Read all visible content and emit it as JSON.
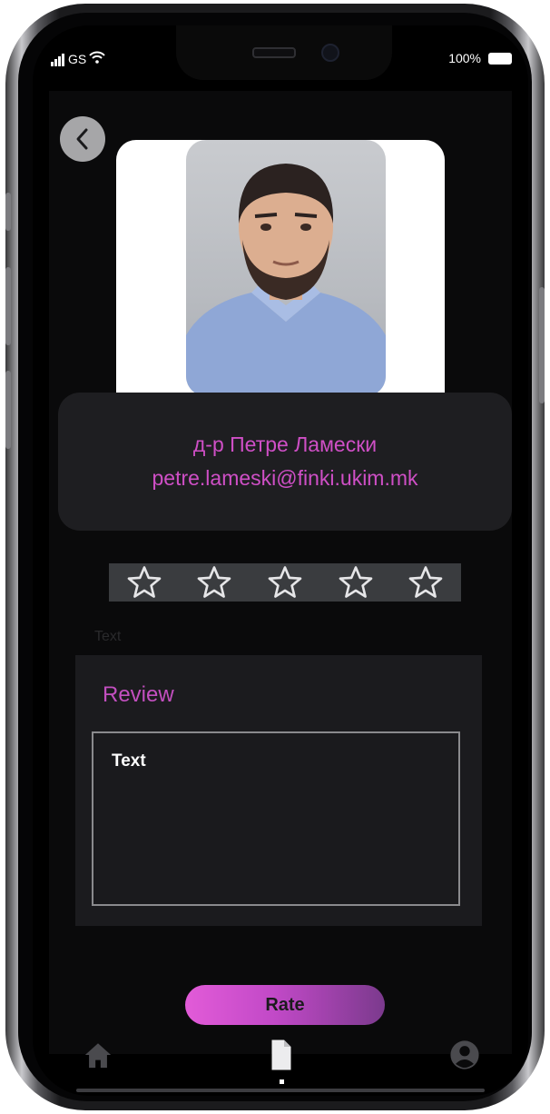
{
  "status_bar": {
    "carrier": "GS",
    "battery": "100%"
  },
  "profile": {
    "name": "д-р Петре Ламески",
    "email": "petre.lameski@finki.ukim.mk"
  },
  "rating": {
    "stars_total": 5,
    "stars_selected": 0
  },
  "review": {
    "ghost_label": "Text",
    "label": "Review",
    "value": "Text"
  },
  "actions": {
    "rate_label": "Rate"
  },
  "tabbar": {
    "items": [
      "home-icon",
      "document-icon",
      "profile-icon"
    ],
    "active": "document-icon"
  },
  "colors": {
    "accent": "#cf4fc6",
    "background": "#0a0a0b",
    "card": "#1e1e21"
  }
}
